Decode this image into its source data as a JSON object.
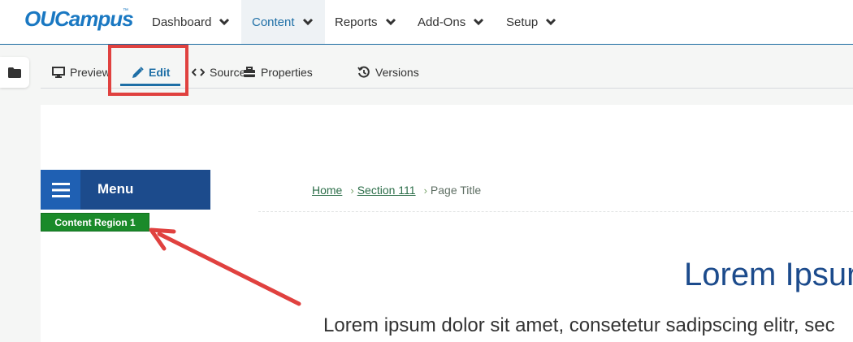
{
  "brand": {
    "logo_text": "OUCampus",
    "tm": "™",
    "accent": "#1e6fa6",
    "highlight": "#e0413f"
  },
  "nav": {
    "items": [
      {
        "label": "Dashboard"
      },
      {
        "label": "Content",
        "active": true
      },
      {
        "label": "Reports"
      },
      {
        "label": "Add-Ons"
      },
      {
        "label": "Setup"
      }
    ]
  },
  "tabs": {
    "preview": "Preview",
    "edit": "Edit",
    "source": "Source",
    "properties": "Properties",
    "versions": "Versions"
  },
  "page": {
    "menu_label": "Menu",
    "region_label": "Content Region 1",
    "breadcrumb": {
      "home": "Home",
      "section": "Section 111",
      "current": "Page Title"
    },
    "heading": "Lorem Ipsur",
    "body": "Lorem ipsum dolor sit amet, consetetur sadipscing elitr, sec",
    "colors": {
      "menu_bar": "#1c4b8c",
      "region_tag": "#1a8a2a"
    }
  }
}
